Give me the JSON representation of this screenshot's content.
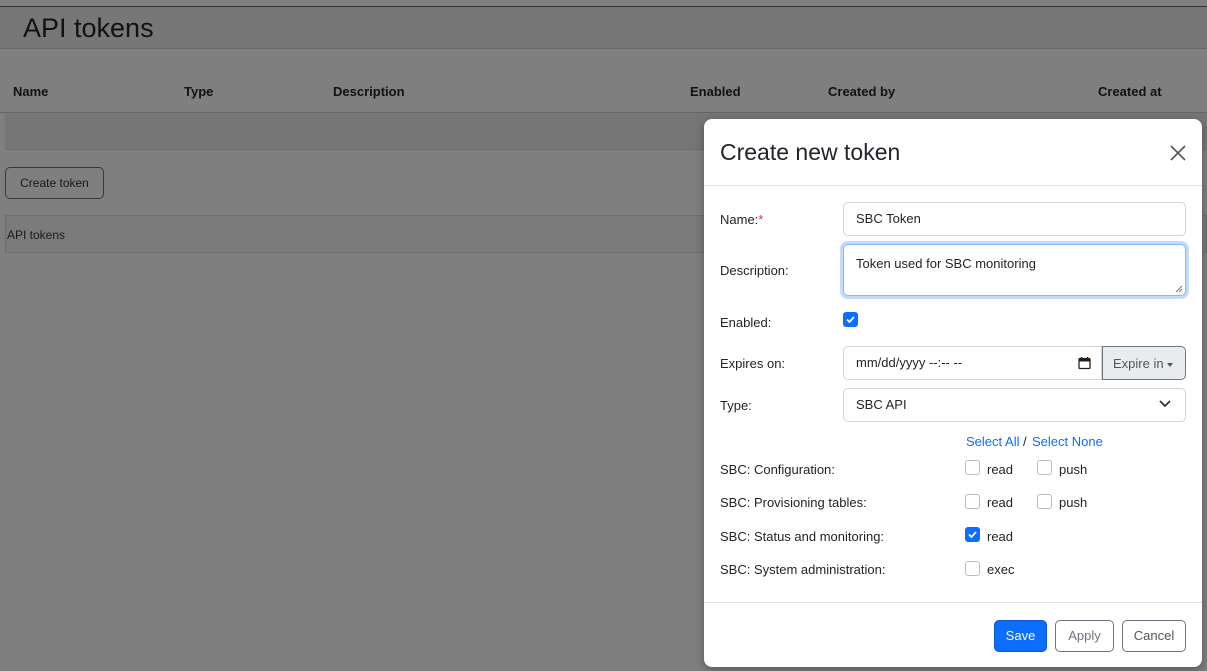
{
  "page": {
    "title": "API tokens",
    "table_headers": [
      "Name",
      "Type",
      "Description",
      "Enabled",
      "Created by",
      "Created at"
    ],
    "create_button": "Create token",
    "footer_label": "API tokens"
  },
  "modal": {
    "title": "Create new token",
    "name": {
      "label": "Name:",
      "required_mark": "*",
      "value": "SBC Token"
    },
    "description": {
      "label": "Description:",
      "value": "Token used for SBC monitoring"
    },
    "enabled": {
      "label": "Enabled:",
      "checked": true
    },
    "expires": {
      "label": "Expires on:",
      "placeholder": "mm/dd/yyyy --:-- --",
      "button": "Expire in"
    },
    "type": {
      "label": "Type:",
      "value": "SBC API"
    },
    "select_all": "Select All",
    "select_sep": "/",
    "select_none": "Select None",
    "permissions": [
      {
        "label": "SBC: Configuration:",
        "options": [
          {
            "name": "read",
            "checked": false
          },
          {
            "name": "push",
            "checked": false
          }
        ]
      },
      {
        "label": "SBC: Provisioning tables:",
        "options": [
          {
            "name": "read",
            "checked": false
          },
          {
            "name": "push",
            "checked": false
          }
        ]
      },
      {
        "label": "SBC: Status and monitoring:",
        "options": [
          {
            "name": "read",
            "checked": true
          }
        ]
      },
      {
        "label": "SBC: System administration:",
        "options": [
          {
            "name": "exec",
            "checked": false
          }
        ]
      }
    ],
    "buttons": {
      "save": "Save",
      "apply": "Apply",
      "cancel": "Cancel"
    }
  },
  "colors": {
    "accent": "#0d6efd",
    "required": "#dc3545",
    "backdrop": "rgba(0,0,0,0.5)"
  },
  "icons": {
    "close": "close-icon",
    "calendar": "calendar-icon",
    "chevron": "chevron-down-icon",
    "check": "check-icon"
  }
}
